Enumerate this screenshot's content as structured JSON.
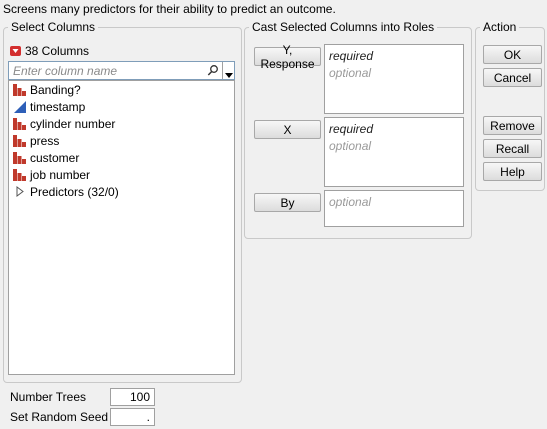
{
  "description": "Screens many predictors for their ability to predict an outcome.",
  "select_columns": {
    "title": "Select Columns",
    "count_label": "38 Columns",
    "search_placeholder": "Enter column name",
    "items": [
      {
        "label": "Banding?",
        "icon": "nominal-bar-icon"
      },
      {
        "label": "timestamp",
        "icon": "continuous-triangle-icon"
      },
      {
        "label": "cylinder number",
        "icon": "nominal-bar-icon"
      },
      {
        "label": "press",
        "icon": "nominal-bar-icon"
      },
      {
        "label": "customer",
        "icon": "nominal-bar-icon"
      },
      {
        "label": "job number",
        "icon": "nominal-bar-icon"
      },
      {
        "label": "Predictors (32/0)",
        "icon": "collapse-triangle-icon"
      }
    ]
  },
  "cast": {
    "title": "Cast Selected Columns into Roles",
    "roles": [
      {
        "button": "Y, Response",
        "required": "required",
        "optional": "optional"
      },
      {
        "button": "X",
        "required": "required",
        "optional": "optional"
      },
      {
        "button": "By",
        "optional": "optional"
      }
    ]
  },
  "action": {
    "title": "Action",
    "ok": "OK",
    "cancel": "Cancel",
    "remove": "Remove",
    "recall": "Recall",
    "help": "Help"
  },
  "options": {
    "number_trees_label": "Number Trees",
    "number_trees_value": "100",
    "random_seed_label": "Set Random Seed",
    "random_seed_value": "."
  },
  "colors": {
    "nominal_icon": "#c0392b",
    "continuous_icon": "#2e5fb8",
    "dropdown_red": "#d32f2f"
  }
}
